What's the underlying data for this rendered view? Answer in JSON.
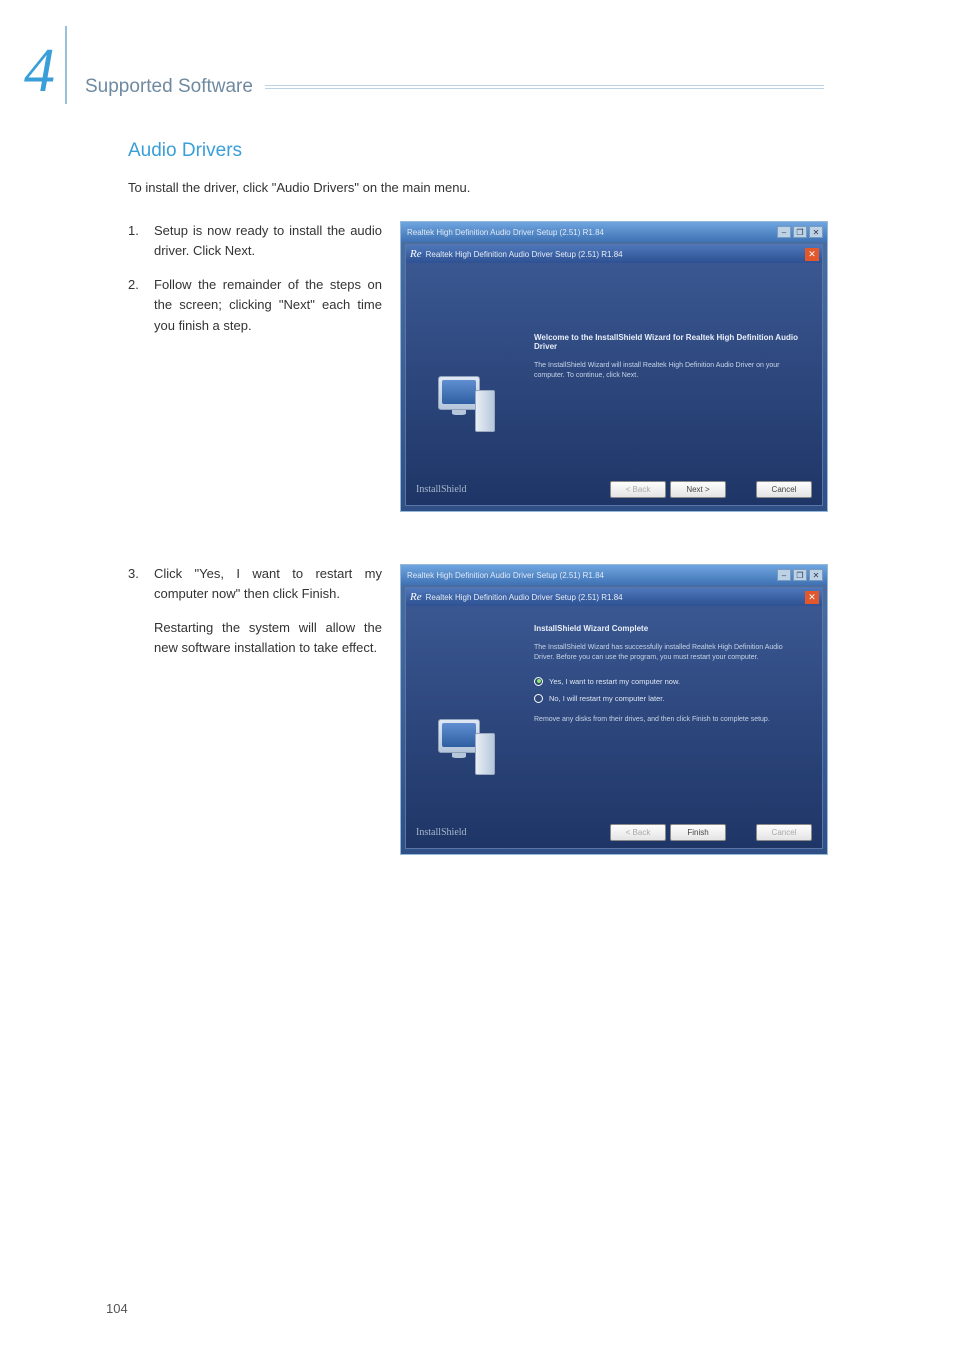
{
  "chapter": {
    "number": "4",
    "title": "Supported Software"
  },
  "section": {
    "title": "Audio Drivers",
    "intro": "To install the driver, click \"Audio Drivers\" on the main menu."
  },
  "steps": [
    {
      "num": "1.",
      "text": "Setup is now ready to install the audio driver. Click Next."
    },
    {
      "num": "2.",
      "text": "Follow the remainder of the steps on the screen; clicking \"Next\" each time you finish a step."
    },
    {
      "num": "3.",
      "text": "Click \"Yes, I want to restart my computer now\" then click Finish."
    }
  ],
  "restart_note": "Restarting the system will allow the new software installation to take effect.",
  "installer1": {
    "outer_title": "Realtek High Definition Audio Driver Setup (2.51) R1.84",
    "inner_logo": "Re",
    "inner_title": "Realtek High Definition Audio Driver Setup (2.51) R1.84",
    "heading": "Welcome to the InstallShield Wizard for Realtek High Definition Audio Driver",
    "body": "The InstallShield Wizard will install Realtek High Definition Audio Driver on your computer. To continue, click Next.",
    "brand": "InstallShield",
    "back": "< Back",
    "next": "Next >",
    "cancel": "Cancel"
  },
  "installer2": {
    "outer_title": "Realtek High Definition Audio Driver Setup (2.51) R1.84",
    "inner_logo": "Re",
    "inner_title": "Realtek High Definition Audio Driver Setup (2.51) R1.84",
    "heading": "InstallShield Wizard Complete",
    "body": "The InstallShield Wizard has successfully installed Realtek High Definition Audio Driver. Before you can use the program, you must restart your computer.",
    "opt_yes": "Yes, I want to restart my computer now.",
    "opt_no": "No, I will restart my computer later.",
    "remove": "Remove any disks from their drives, and then click Finish to complete setup.",
    "brand": "InstallShield",
    "back": "< Back",
    "finish": "Finish",
    "cancel": "Cancel"
  },
  "page_number": "104",
  "glyphs": {
    "min": "–",
    "max": "❐",
    "close": "✕"
  }
}
